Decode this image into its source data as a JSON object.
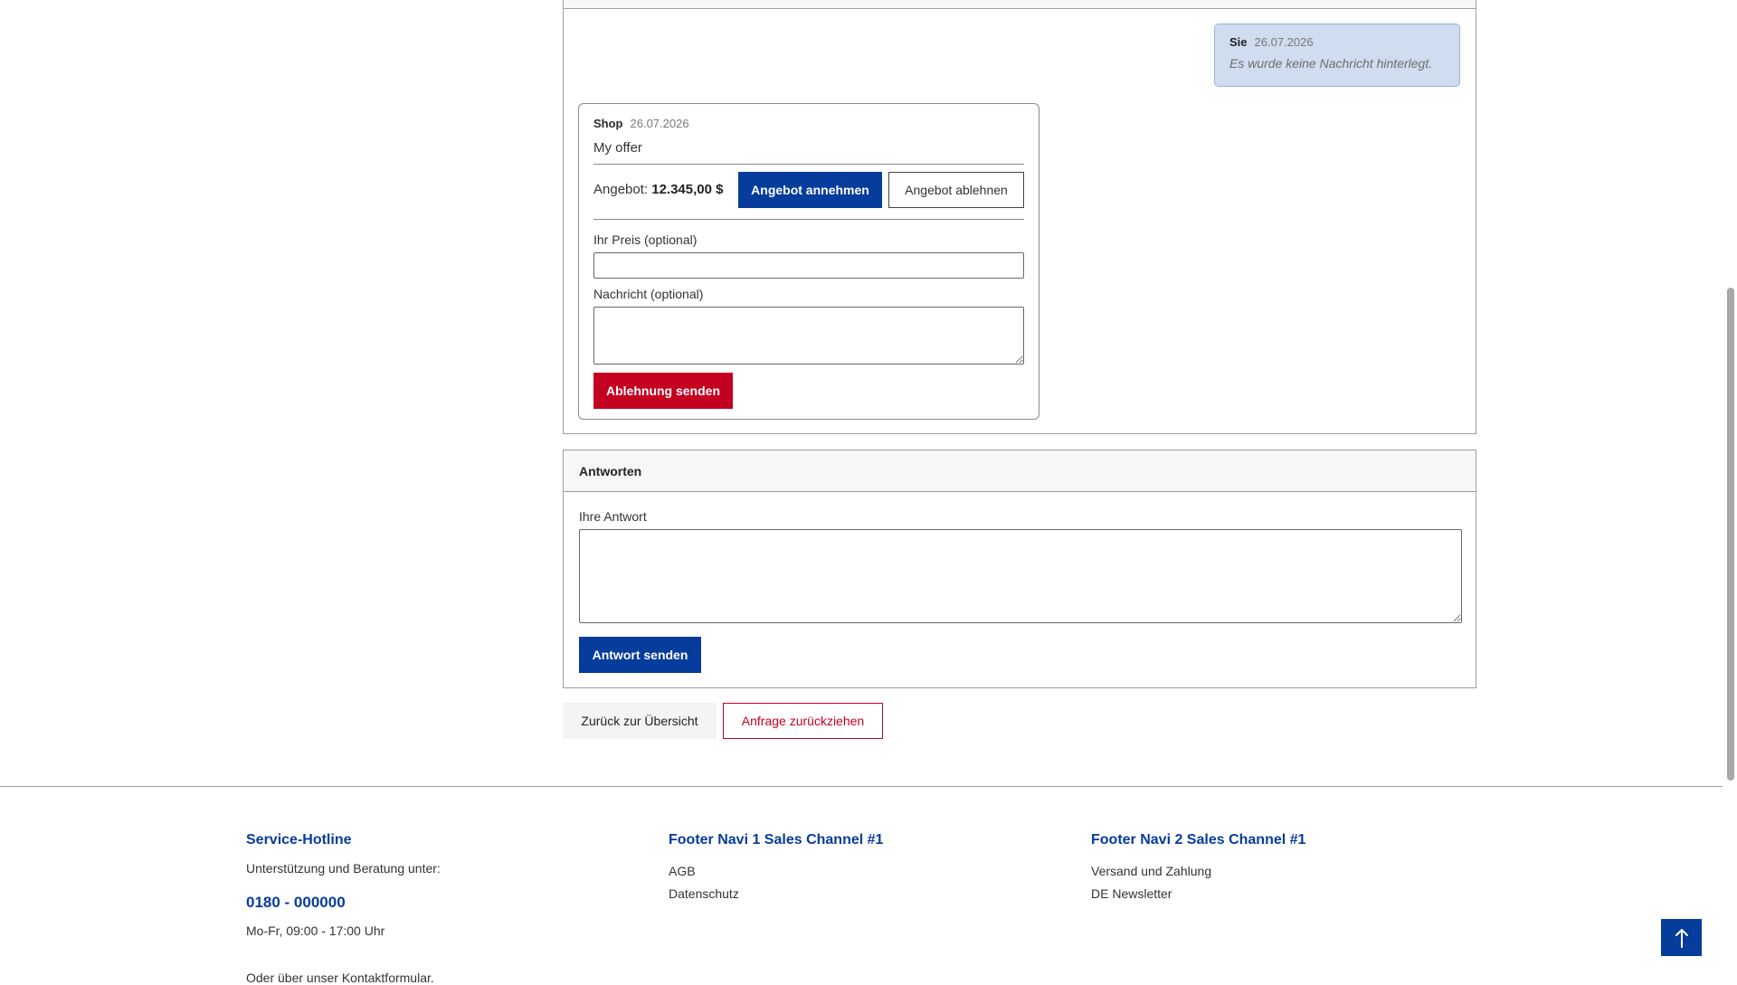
{
  "conversation": {
    "user_message": {
      "author": "Sie",
      "date": "26.07.2026",
      "text": "Es wurde keine Nachricht hinterlegt."
    },
    "shop_offer": {
      "author": "Shop",
      "date": "26.07.2026",
      "title": "My offer",
      "offer_label": "Angebot:",
      "offer_amount": "12.345,00 $",
      "accept_label": "Angebot annehmen",
      "decline_label": "Angebot ablehnen",
      "price_label": "Ihr Preis (optional)",
      "price_value": "",
      "message_label": "Nachricht (optional)",
      "message_value": "",
      "send_rejection_label": "Ablehnung senden"
    }
  },
  "reply": {
    "heading": "Antworten",
    "answer_label": "Ihre Antwort",
    "answer_value": "",
    "send_label": "Antwort senden"
  },
  "actions": {
    "back_label": "Zurück zur Übersicht",
    "withdraw_label": "Anfrage zurückziehen"
  },
  "footer": {
    "hotline": {
      "title": "Service-Hotline",
      "intro": "Unterstützung und Beratung unter:",
      "phone": "0180 - 000000",
      "hours": "Mo-Fr, 09:00 - 17:00 Uhr",
      "cutoff_text": "Oder über unser Kontaktformular."
    },
    "navi1": {
      "title": "Footer Navi 1 Sales Channel #1",
      "links": [
        "AGB",
        "Datenschutz"
      ]
    },
    "navi2": {
      "title": "Footer Navi 2 Sales Channel #1",
      "links": [
        "Versand und Zahlung",
        "DE Newsletter"
      ]
    }
  },
  "icons": {
    "scroll_top": "arrow-up-icon"
  },
  "colors": {
    "primary": "#063c9c",
    "danger": "#c40021",
    "user_bubble": "#d0dcef"
  }
}
